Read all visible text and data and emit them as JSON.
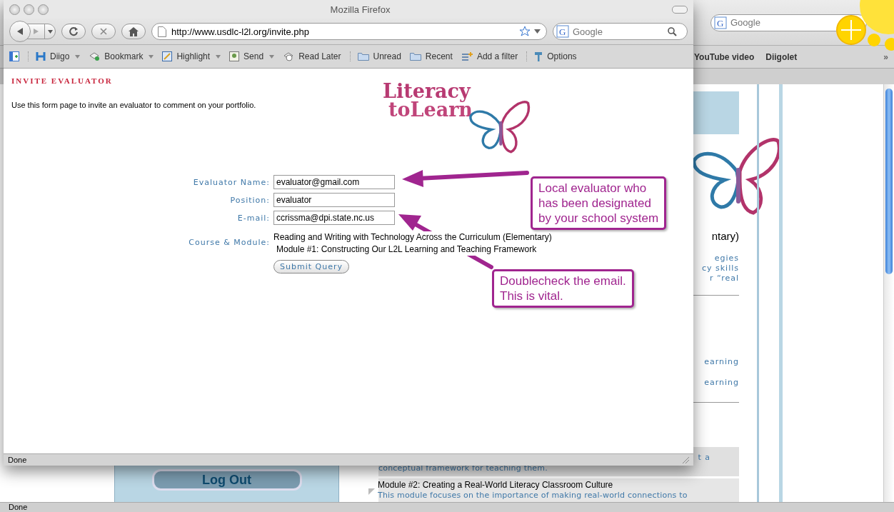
{
  "back_window": {
    "search": {
      "engine_letter": "G",
      "placeholder": "Google"
    },
    "bookmarks": [
      "YouTube video",
      "Diigolet"
    ],
    "bookmarks_overflow": "»",
    "logout_button": "Log Out",
    "course_title": "ntary)",
    "description_lines": [
      "egies",
      "cy skills",
      "r “real"
    ],
    "module_links": [
      "earning",
      "earning"
    ],
    "module_1": {
      "tail": "t a",
      "description": "conceptual framework for teaching them."
    },
    "module_2": {
      "title": "Module #2: Creating a Real-World Literacy Classroom Culture",
      "description": "This module focuses on the importance of making real-world connections to"
    },
    "status_bar": "Done"
  },
  "front_window": {
    "title": "Mozilla Firefox",
    "address": "http://www.usdlc-l2l.org/invite.php",
    "search": {
      "engine_letter": "G",
      "placeholder": "Google"
    },
    "toolbar": [
      {
        "kind": "sidebar",
        "has_menu": false,
        "group_start": false
      },
      {
        "kind": "diigo",
        "label": "Diigo",
        "has_menu": true,
        "group_start": true
      },
      {
        "kind": "bookmark",
        "label": "Bookmark",
        "has_menu": true,
        "group_start": false
      },
      {
        "kind": "highlight",
        "label": "Highlight",
        "has_menu": true,
        "group_start": false
      },
      {
        "kind": "send",
        "label": "Send",
        "has_menu": true,
        "group_start": false
      },
      {
        "kind": "readlater",
        "label": "Read Later",
        "has_menu": false,
        "group_start": false
      },
      {
        "kind": "folder",
        "label": "Unread",
        "has_menu": false,
        "group_start": true
      },
      {
        "kind": "folder",
        "label": "Recent",
        "has_menu": false,
        "group_start": false
      },
      {
        "kind": "filter",
        "label": "Add a filter",
        "has_menu": false,
        "group_start": false
      },
      {
        "kind": "options",
        "label": "Options",
        "has_menu": false,
        "group_start": true
      }
    ],
    "heading": "INVITE EVALUATOR",
    "intro": "Use this form page to invite an evaluator to comment on your portfolio.",
    "logo": {
      "line_1": "Literacy",
      "line_2": "toLearn"
    },
    "fields": [
      {
        "label": "Evaluator Name:",
        "value": "evaluator@gmail.com"
      },
      {
        "label": "Position:",
        "value": "evaluator"
      },
      {
        "label": "E-mail:",
        "value": "ccrissma@dpi.state.nc.us"
      }
    ],
    "course": {
      "label": "Course & Module:",
      "lines": [
        "Reading and Writing with Technology Across the Curriculum (Elementary)",
        "Module #1: Constructing Our L2L Learning and Teaching Framework"
      ]
    },
    "submit_button": "Submit Query",
    "status_bar": "Done"
  },
  "callouts": [
    {
      "lines": [
        "Local evaluator who",
        "has been designated",
        "by your school system"
      ]
    },
    {
      "lines": [
        "Doublecheck the email.",
        "This is vital."
      ]
    }
  ]
}
